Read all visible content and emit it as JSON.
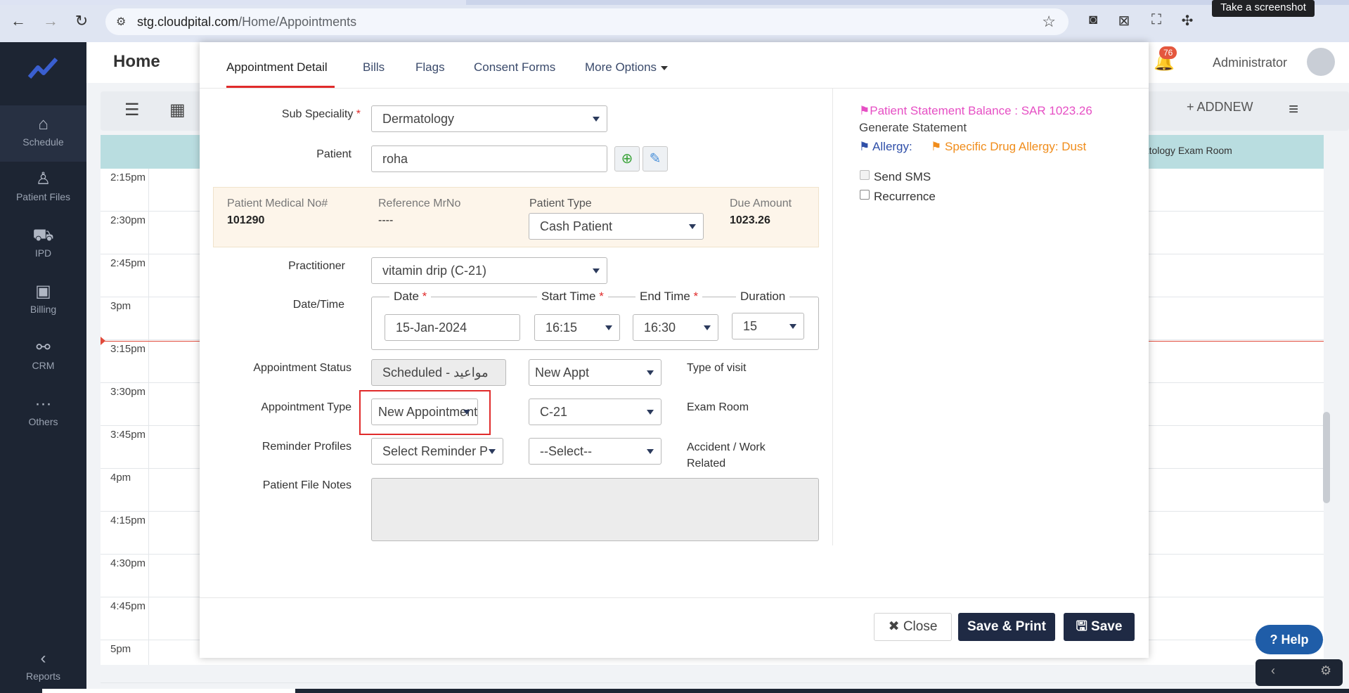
{
  "browser": {
    "url_host": "stg.cloudpital.com",
    "url_path": "/Home/Appointments",
    "tooltip": "Take a screenshot"
  },
  "sidebar": {
    "items": [
      {
        "label": "Schedule",
        "icon": "calendar-icon"
      },
      {
        "label": "Patient Files",
        "icon": "person-icon"
      },
      {
        "label": "IPD",
        "icon": "bed-icon"
      },
      {
        "label": "Billing",
        "icon": "money-icon"
      },
      {
        "label": "CRM",
        "icon": "crm-icon"
      },
      {
        "label": "Others",
        "icon": "more-icon"
      },
      {
        "label": "Reports",
        "icon": "chevron-left-icon"
      }
    ]
  },
  "header": {
    "title": "Home",
    "notification_count": "76",
    "user": "Administrator"
  },
  "toolbar": {
    "addnew_label": "ADDNEW"
  },
  "calendar": {
    "room_header": "natology Exam Room",
    "times": [
      "2:15pm",
      "2:30pm",
      "2:45pm",
      "3pm",
      "3:15pm",
      "3:30pm",
      "3:45pm",
      "4pm",
      "4:15pm",
      "4:30pm",
      "4:45pm",
      "5pm"
    ]
  },
  "modal": {
    "tabs": [
      "Appointment Detail",
      "Bills",
      "Flags",
      "Consent Forms",
      "More Options"
    ],
    "sub_speciality": {
      "label": "Sub Speciality",
      "value": "Dermatology"
    },
    "patient": {
      "label": "Patient",
      "value": "roha"
    },
    "info": {
      "medical_no_label": "Patient Medical No#",
      "medical_no": "101290",
      "reference_label": "Reference MrNo",
      "reference": "----",
      "patient_type_label": "Patient Type",
      "patient_type": "Cash Patient",
      "due_label": "Due Amount",
      "due": "1023.26"
    },
    "practitioner": {
      "label": "Practitioner",
      "value": "vitamin drip (C-21)"
    },
    "datetime": {
      "label": "Date/Time",
      "date_label": "Date",
      "date": "15-Jan-2024",
      "start_label": "Start Time",
      "start": "16:15",
      "end_label": "End Time",
      "end": "16:30",
      "duration_label": "Duration",
      "duration": "15"
    },
    "status": {
      "label": "Appointment Status",
      "value": "Scheduled - مواعيد",
      "visit_value": "New Appt",
      "visit_label": "Type of visit"
    },
    "appt_type": {
      "label": "Appointment Type",
      "value": "New Appointment",
      "room_value": "C-21",
      "room_label": "Exam Room"
    },
    "reminder": {
      "label": "Reminder Profiles",
      "value": "Select Reminder P",
      "accident_value": "--Select--",
      "accident_label": "Accident / Work Related"
    },
    "notes": {
      "label": "Patient File Notes"
    },
    "right": {
      "balance": "Patient Statement Balance : SAR 1023.26",
      "generate": "Generate Statement",
      "allergy_label": "Allergy:",
      "allergy_value": "Specific Drug Allergy: Dust",
      "send_sms": "Send SMS",
      "recurrence": "Recurrence"
    },
    "footer": {
      "close": "Close",
      "save_print": "Save & Print",
      "save": "Save"
    }
  },
  "help": {
    "label": "Help"
  },
  "colors": {
    "accent_red": "#e02b2b",
    "sidebar_bg": "#1d2533",
    "balance_pink": "#e64fc4",
    "allergy_orange": "#f08c1a",
    "flag_blue": "#2f4fa8"
  }
}
